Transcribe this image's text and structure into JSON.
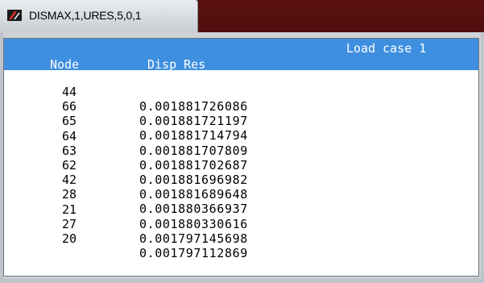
{
  "window": {
    "title": "DISMAX,1,URES,5,0,1",
    "app_icon": "app-logo-icon"
  },
  "results": {
    "load_case": "Load case 1",
    "columns": [
      "Node",
      "Disp_Res"
    ],
    "rows": [
      {
        "node": "44",
        "disp": "0.001881726086"
      },
      {
        "node": "66",
        "disp": "0.001881721197"
      },
      {
        "node": "65",
        "disp": "0.001881714794"
      },
      {
        "node": "64",
        "disp": "0.001881707809"
      },
      {
        "node": "63",
        "disp": "0.001881702687"
      },
      {
        "node": "62",
        "disp": "0.001881696982"
      },
      {
        "node": "42",
        "disp": "0.001881689648"
      },
      {
        "node": "28",
        "disp": "0.001880366937"
      },
      {
        "node": "21",
        "disp": "0.001880330616"
      },
      {
        "node": "27",
        "disp": "0.001797145698"
      },
      {
        "node": "20",
        "disp": "0.001797112869"
      }
    ]
  },
  "colors": {
    "header_band": "#3f8fe0",
    "header_text": "#ffffff",
    "body_text": "#000000"
  }
}
